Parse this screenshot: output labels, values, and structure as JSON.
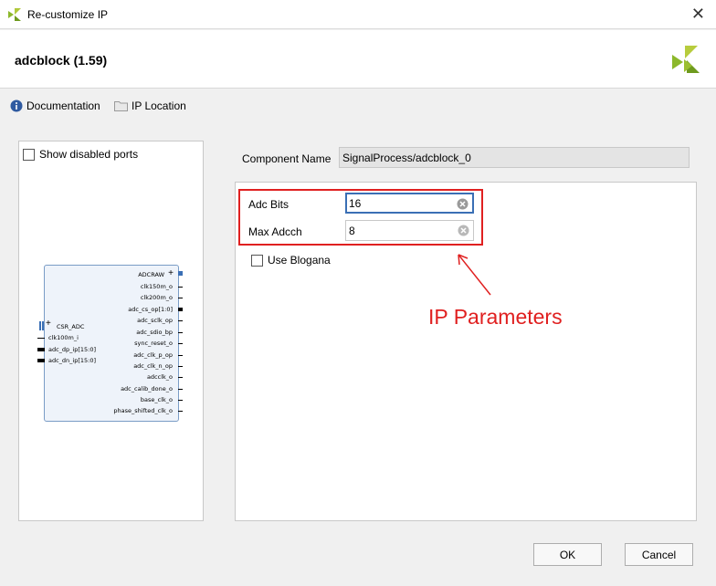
{
  "window": {
    "title": "Re-customize IP"
  },
  "header": {
    "ip_name": "adcblock (1.59)"
  },
  "links": {
    "documentation": "Documentation",
    "ip_location": "IP Location"
  },
  "left_panel": {
    "show_disabled_ports": "Show disabled ports",
    "block": {
      "right_ports": [
        "ADCRAW",
        "clk150m_o",
        "clk200m_o",
        "adc_cs_op[1:0]",
        "adc_sclk_op",
        "adc_sdio_bp",
        "sync_reset_o",
        "adc_clk_p_op",
        "adc_clk_n_op",
        "adcclk_o",
        "adc_calib_done_o",
        "base_clk_o",
        "phase_shifted_clk_o"
      ],
      "left_ports": [
        "CSR_ADC",
        "clk100m_i",
        "adc_dp_ip[15:0]",
        "adc_dn_ip[15:0]"
      ]
    }
  },
  "component": {
    "label": "Component Name",
    "value": "SignalProcess/adcblock_0"
  },
  "params": [
    {
      "label": "Adc Bits",
      "value": "16"
    },
    {
      "label": "Max Adcch",
      "value": "8"
    }
  ],
  "use_blogana": "Use Blogana",
  "annotation": "IP Parameters",
  "buttons": {
    "ok": "OK",
    "cancel": "Cancel"
  },
  "colors": {
    "annotation": "#e02020",
    "logo": "#8cb82b",
    "focus": "#3a6fb5"
  }
}
